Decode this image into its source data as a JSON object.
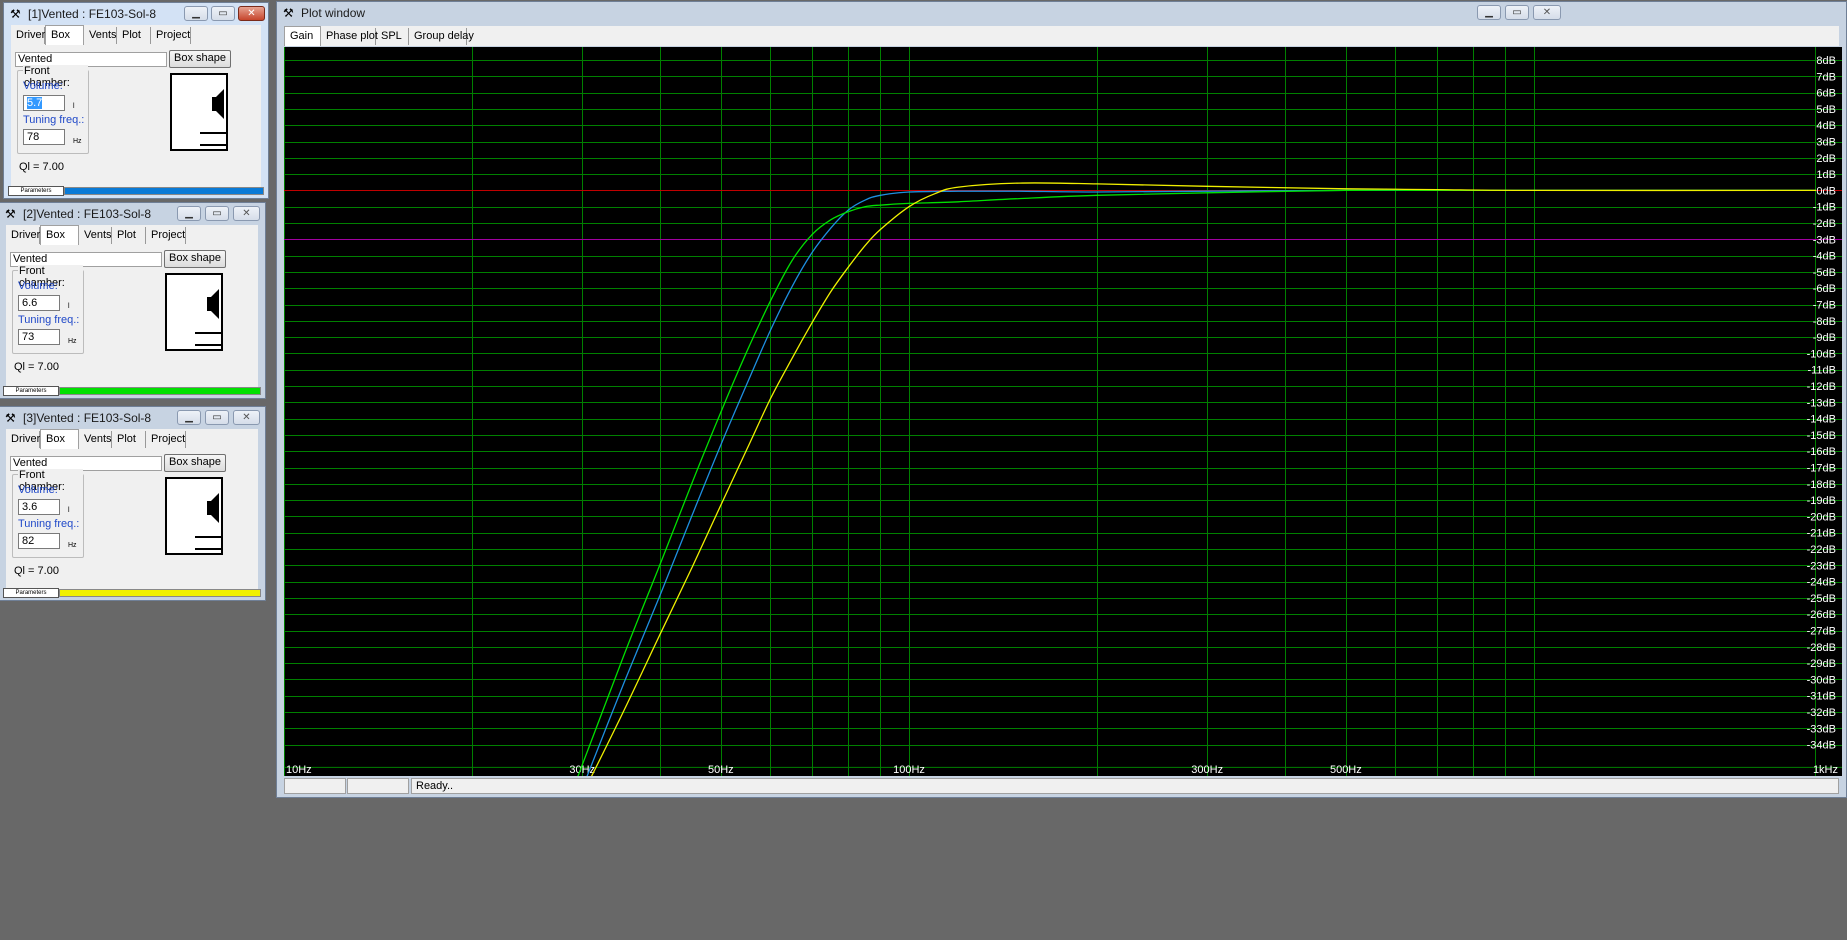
{
  "windows": [
    {
      "title": "[1]Vented : FE103-Sol-8",
      "tabs": [
        "Driver",
        "Box",
        "Vents",
        "Plot",
        "Project"
      ],
      "selected_tab": "Box",
      "box_type": "Vented",
      "box_shape_label": "Box shape",
      "front_chamber_label": "Front chamber:",
      "volume_label": "Volume:",
      "volume_value": "5.7",
      "volume_unit": "l",
      "tuning_label": "Tuning freq.:",
      "tuning_value": "78",
      "tuning_unit": "Hz",
      "ql_text": "Ql = 7.00",
      "parameters_label": "Parameters",
      "color": "#0a7ad6"
    },
    {
      "title": "[2]Vented : FE103-Sol-8",
      "tabs": [
        "Driver",
        "Box",
        "Vents",
        "Plot",
        "Project"
      ],
      "selected_tab": "Box",
      "box_type": "Vented",
      "box_shape_label": "Box shape",
      "front_chamber_label": "Front chamber:",
      "volume_label": "Volume:",
      "volume_value": "6.6",
      "volume_unit": "l",
      "tuning_label": "Tuning freq.:",
      "tuning_value": "73",
      "tuning_unit": "Hz",
      "ql_text": "Ql = 7.00",
      "parameters_label": "Parameters",
      "color": "#00e000"
    },
    {
      "title": "[3]Vented : FE103-Sol-8",
      "tabs": [
        "Driver",
        "Box",
        "Vents",
        "Plot",
        "Project"
      ],
      "selected_tab": "Box",
      "box_type": "Vented",
      "box_shape_label": "Box shape",
      "front_chamber_label": "Front chamber:",
      "volume_label": "Volume:",
      "volume_value": "3.6",
      "volume_unit": "l",
      "tuning_label": "Tuning freq.:",
      "tuning_value": "82",
      "tuning_unit": "Hz",
      "ql_text": "Ql = 7.00",
      "parameters_label": "Parameters",
      "color": "#f0f000"
    }
  ],
  "plot_window": {
    "title": "Plot window",
    "tabs": [
      "Gain",
      "Phase plot",
      "SPL",
      "Group delay"
    ],
    "selected_tab": "Gain",
    "status_text": "Ready.."
  },
  "chart_data": {
    "type": "line",
    "x_scale": "log",
    "xlim": [
      10,
      1000
    ],
    "ylim": [
      -35,
      9
    ],
    "x_tick_labels": [
      {
        "x": 10,
        "label": "10Hz"
      },
      {
        "x": 30,
        "label": "30Hz"
      },
      {
        "x": 50,
        "label": "50Hz"
      },
      {
        "x": 100,
        "label": "100Hz"
      },
      {
        "x": 300,
        "label": "300Hz"
      },
      {
        "x": 500,
        "label": "500Hz"
      },
      {
        "x": 1000,
        "label": "1kHz"
      }
    ],
    "y_ticks": [
      8,
      7,
      6,
      5,
      4,
      3,
      2,
      1,
      0,
      -1,
      -2,
      -3,
      -4,
      -5,
      -6,
      -7,
      -8,
      -9,
      -10,
      -11,
      -12,
      -13,
      -14,
      -15,
      -16,
      -17,
      -18,
      -19,
      -20,
      -21,
      -22,
      -23,
      -24,
      -25,
      -26,
      -27,
      -28,
      -29,
      -30,
      -31,
      -32,
      -33,
      -34
    ],
    "y_unit": "dB",
    "reference_lines": [
      {
        "y": 0,
        "color": "#c00000"
      },
      {
        "y": -3,
        "color": "#a000a0"
      }
    ],
    "grid": true,
    "grid_color": "#008000",
    "series": [
      {
        "color": "#1e8fe0",
        "x": [
          30.5,
          35,
          40,
          45,
          50,
          55,
          60,
          65,
          70,
          75,
          80,
          85,
          90,
          100,
          120,
          150,
          200,
          300,
          500,
          700,
          1000
        ],
        "y": [
          -36,
          -30.2,
          -24.8,
          -19.9,
          -15.6,
          -11.9,
          -8.6,
          -5.9,
          -3.8,
          -2.3,
          -1.2,
          -0.6,
          -0.3,
          -0.1,
          -0.05,
          -0.05,
          -0.1,
          -0.05,
          0,
          0,
          0
        ]
      },
      {
        "color": "#00e000",
        "x": [
          29.5,
          35,
          40,
          45,
          50,
          55,
          60,
          65,
          70,
          75,
          80,
          85,
          90,
          100,
          120,
          150,
          200,
          300,
          500,
          700,
          1000
        ],
        "y": [
          -36,
          -28.5,
          -22.9,
          -17.9,
          -13.6,
          -9.9,
          -6.8,
          -4.3,
          -2.7,
          -1.8,
          -1.3,
          -1.0,
          -0.9,
          -0.8,
          -0.7,
          -0.5,
          -0.3,
          -0.15,
          0,
          0,
          0
        ]
      },
      {
        "color": "#f0f000",
        "x": [
          31,
          35,
          40,
          45,
          50,
          55,
          60,
          65,
          70,
          75,
          80,
          85,
          90,
          100,
          110,
          120,
          150,
          200,
          300,
          500,
          700,
          1000
        ],
        "y": [
          -36,
          -31.9,
          -27.2,
          -23.1,
          -19.3,
          -15.9,
          -12.8,
          -10.3,
          -8.1,
          -6.2,
          -4.7,
          -3.4,
          -2.4,
          -1.0,
          -0.2,
          0.2,
          0.45,
          0.4,
          0.25,
          0.1,
          0.05,
          0
        ]
      }
    ]
  }
}
